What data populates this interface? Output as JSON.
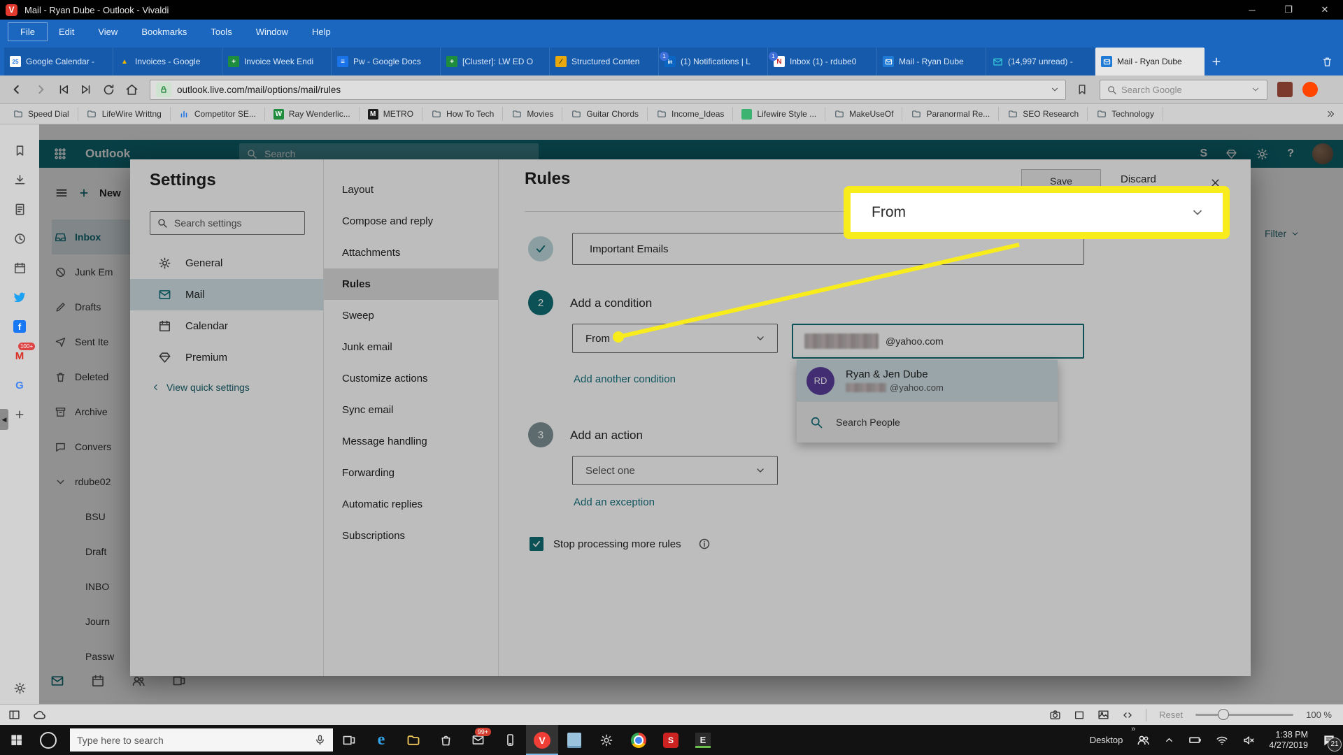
{
  "window": {
    "title": "Mail - Ryan Dube - Outlook - Vivaldi"
  },
  "menu_bar": {
    "items": [
      "File",
      "Edit",
      "View",
      "Bookmarks",
      "Tools",
      "Window",
      "Help"
    ]
  },
  "tab_bar": {
    "tabs": [
      {
        "label": "Google Calendar -",
        "icon": "gcal",
        "active": false
      },
      {
        "label": "Invoices - Google",
        "icon": "drive",
        "active": false
      },
      {
        "label": "Invoice Week Endi",
        "icon": "sheets",
        "active": false
      },
      {
        "label": "Pw - Google Docs",
        "icon": "docs",
        "active": false
      },
      {
        "label": "[Cluster]: LW ED O",
        "icon": "sheets",
        "active": false
      },
      {
        "label": "Structured Conten",
        "icon": "lucid",
        "active": false
      },
      {
        "label": "(1) Notifications | L",
        "icon": "linkedin",
        "badge": "1",
        "active": false
      },
      {
        "label": "Inbox (1) - rdube0",
        "icon": "inboxapp",
        "badge": "1",
        "active": false
      },
      {
        "label": "Mail - Ryan Dube",
        "icon": "outlook",
        "active": false
      },
      {
        "label": "(14,997 unread) -",
        "icon": "mailteal",
        "active": false
      },
      {
        "label": "Mail - Ryan Dube",
        "icon": "outlook",
        "active": true
      }
    ]
  },
  "address_bar": {
    "url": "outlook.live.com/mail/options/mail/rules",
    "search_placeholder": "Search Google"
  },
  "bookmarks_bar": {
    "items": [
      {
        "label": "Speed Dial",
        "icon": "folder"
      },
      {
        "label": "LifeWire Writtng",
        "icon": "folder"
      },
      {
        "label": "Competitor SE...",
        "icon": "chart"
      },
      {
        "label": "Ray Wenderlic...",
        "icon": "wenderlich"
      },
      {
        "label": "METRO",
        "icon": "metro"
      },
      {
        "label": "How To Tech",
        "icon": "folder"
      },
      {
        "label": "Movies",
        "icon": "folder"
      },
      {
        "label": "Guitar Chords",
        "icon": "folder"
      },
      {
        "label": "Income_Ideas",
        "icon": "folder"
      },
      {
        "label": "Lifewire Style ...",
        "icon": "lifewire"
      },
      {
        "label": "MakeUseOf",
        "icon": "folder"
      },
      {
        "label": "Paranormal Re...",
        "icon": "folder"
      },
      {
        "label": "SEO Research",
        "icon": "folder"
      },
      {
        "label": "Technology",
        "icon": "folder"
      }
    ]
  },
  "panel_bar": {
    "tool_icons": [
      "bookmark",
      "download",
      "document",
      "history",
      "calendar"
    ],
    "web_panels": [
      {
        "icon": "twitter"
      },
      {
        "icon": "facebook"
      },
      {
        "icon": "gmail",
        "badge": "100+"
      },
      {
        "icon": "google"
      },
      {
        "icon": "plus"
      }
    ]
  },
  "outlook": {
    "header": {
      "brand": "Outlook",
      "search_placeholder": "Search"
    },
    "mail_sidebar": {
      "new_label": "New",
      "folders": [
        {
          "label": "Inbox",
          "icon": "inbox",
          "selected": true
        },
        {
          "label": "Junk Em",
          "icon": "ban"
        },
        {
          "label": "Drafts",
          "icon": "pencil"
        },
        {
          "label": "Sent Ite",
          "icon": "send"
        },
        {
          "label": "Deleted",
          "icon": "trash"
        },
        {
          "label": "Archive",
          "icon": "archive"
        },
        {
          "label": "Convers",
          "icon": "chat"
        },
        {
          "label": "rdube02",
          "icon": "chevron-down"
        },
        {
          "label": "BSU",
          "child": true
        },
        {
          "label": "Draft",
          "child": true
        },
        {
          "label": "INBO",
          "child": true
        },
        {
          "label": "Journ",
          "child": true
        },
        {
          "label": "Passw",
          "child": true
        }
      ]
    },
    "filter_label": "Filter"
  },
  "settings_dialog": {
    "title": "Settings",
    "search_placeholder": "Search settings",
    "categories": [
      {
        "label": "General",
        "icon": "gear",
        "selected": false
      },
      {
        "label": "Mail",
        "icon": "mail",
        "selected": true
      },
      {
        "label": "Calendar",
        "icon": "calendar",
        "selected": false
      },
      {
        "label": "Premium",
        "icon": "gem",
        "selected": false
      }
    ],
    "quick_settings": "View quick settings",
    "sections": [
      "Layout",
      "Compose and reply",
      "Attachments",
      "Rules",
      "Sweep",
      "Junk email",
      "Customize actions",
      "Sync email",
      "Message handling",
      "Forwarding",
      "Automatic replies",
      "Subscriptions"
    ],
    "selected_section": "Rules"
  },
  "rules_panel": {
    "title": "Rules",
    "save_label": "Save",
    "discard_label": "Discard",
    "rule_name": "Important Emails",
    "step2_number": "2",
    "step3_number": "3",
    "condition_title": "Add a condition",
    "action_title": "Add an action",
    "condition_select": "From",
    "condition_value_suffix": "@yahoo.com",
    "add_condition_link": "Add another condition",
    "action_placeholder": "Select one",
    "add_exception_link": "Add an exception",
    "stop_label": "Stop processing more rules",
    "people_picker": {
      "initials": "RD",
      "name": "Ryan & Jen Dube",
      "email_suffix": "@yahoo.com",
      "search_label": "Search People"
    }
  },
  "callout": {
    "label": "From",
    "highlight_color": "#f8ec1c"
  },
  "status_bar": {
    "reset_label": "Reset",
    "zoom_label": "100 %"
  },
  "taskbar": {
    "search_placeholder": "Type here to search",
    "app_icons": [
      {
        "name": "task-view"
      },
      {
        "name": "edge"
      },
      {
        "name": "file-explorer"
      },
      {
        "name": "store"
      },
      {
        "name": "mail",
        "badge": "99+"
      },
      {
        "name": "phone"
      },
      {
        "name": "vivaldi",
        "active": true
      },
      {
        "name": "notepad"
      },
      {
        "name": "settings"
      },
      {
        "name": "chrome"
      },
      {
        "name": "scrivener"
      },
      {
        "name": "editor"
      }
    ],
    "tray": {
      "desktop_label": "Desktop",
      "time": "1:38 PM",
      "date": "4/27/2019",
      "notification_badge": "21"
    }
  }
}
